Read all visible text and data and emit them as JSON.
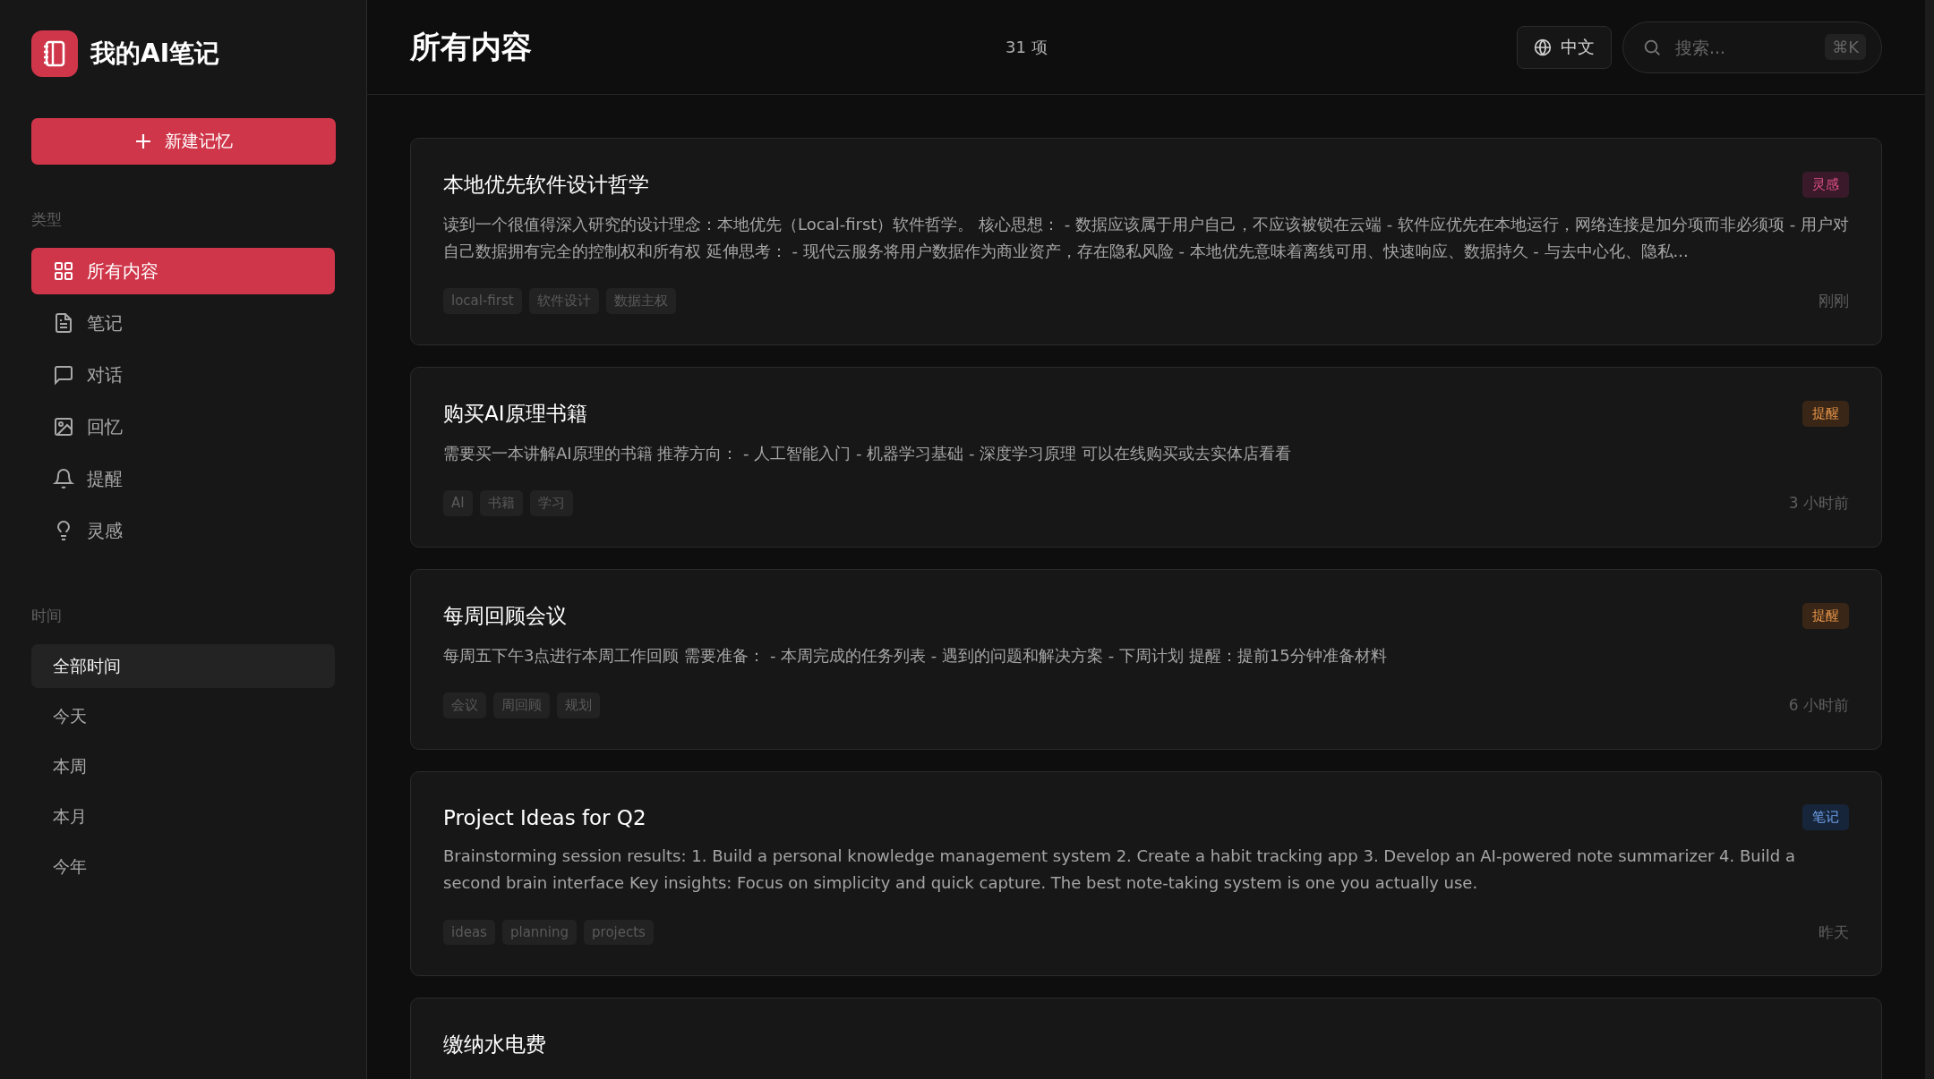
{
  "app": {
    "title": "我的AI笔记",
    "new_button": "新建记忆"
  },
  "sidebar": {
    "type_label": "类型",
    "types": [
      {
        "label": "所有内容",
        "kind": "all",
        "selected": true
      },
      {
        "label": "笔记",
        "kind": "note",
        "selected": false
      },
      {
        "label": "对话",
        "kind": "chat",
        "selected": false
      },
      {
        "label": "回忆",
        "kind": "memory",
        "selected": false
      },
      {
        "label": "提醒",
        "kind": "reminder",
        "selected": false
      },
      {
        "label": "灵感",
        "kind": "inspiration",
        "selected": false
      }
    ],
    "time_label": "时间",
    "times": [
      {
        "label": "全部时间",
        "selected": true
      },
      {
        "label": "今天",
        "selected": false
      },
      {
        "label": "本周",
        "selected": false
      },
      {
        "label": "本月",
        "selected": false
      },
      {
        "label": "今年",
        "selected": false
      }
    ]
  },
  "header": {
    "title": "所有内容",
    "count": "31 项",
    "language": "中文",
    "search_placeholder": "搜索...",
    "shortcut": "⌘K"
  },
  "cards": [
    {
      "title": "本地优先软件设计哲学",
      "badge": {
        "label": "灵感",
        "kind": "inspiration"
      },
      "body": "读到一个很值得深入研究的设计理念：本地优先（Local-first）软件哲学。 核心思想： - 数据应该属于用户自己，不应该被锁在云端 - 软件应优先在本地运行，网络连接是加分项而非必须项 - 用户对自己数据拥有完全的控制权和所有权 延伸思考： - 现代云服务将用户数据作为商业资产，存在隐私风险 - 本地优先意味着离线可用、快速响应、数据持久 - 与去中心化、隐私...",
      "tags": [
        "local-first",
        "软件设计",
        "数据主权"
      ],
      "time": "刚刚"
    },
    {
      "title": "购买AI原理书籍",
      "badge": {
        "label": "提醒",
        "kind": "reminder"
      },
      "body": "需要买一本讲解AI原理的书籍 推荐方向： - 人工智能入门 - 机器学习基础 - 深度学习原理 可以在线购买或去实体店看看",
      "tags": [
        "AI",
        "书籍",
        "学习"
      ],
      "time": "3 小时前"
    },
    {
      "title": "每周回顾会议",
      "badge": {
        "label": "提醒",
        "kind": "reminder"
      },
      "body": "每周五下午3点进行本周工作回顾 需要准备： - 本周完成的任务列表 - 遇到的问题和解决方案 - 下周计划 提醒：提前15分钟准备材料",
      "tags": [
        "会议",
        "周回顾",
        "规划"
      ],
      "time": "6 小时前"
    },
    {
      "title": "Project Ideas for Q2",
      "badge": {
        "label": "笔记",
        "kind": "note"
      },
      "body": "Brainstorming session results: 1. Build a personal knowledge management system 2. Create a habit tracking app 3. Develop an AI-powered note summarizer 4. Build a second brain interface Key insights: Focus on simplicity and quick capture. The best note-taking system is one you actually use.",
      "tags": [
        "ideas",
        "planning",
        "projects"
      ],
      "time": "昨天"
    },
    {
      "title": "缴纳水电费"
    }
  ]
}
